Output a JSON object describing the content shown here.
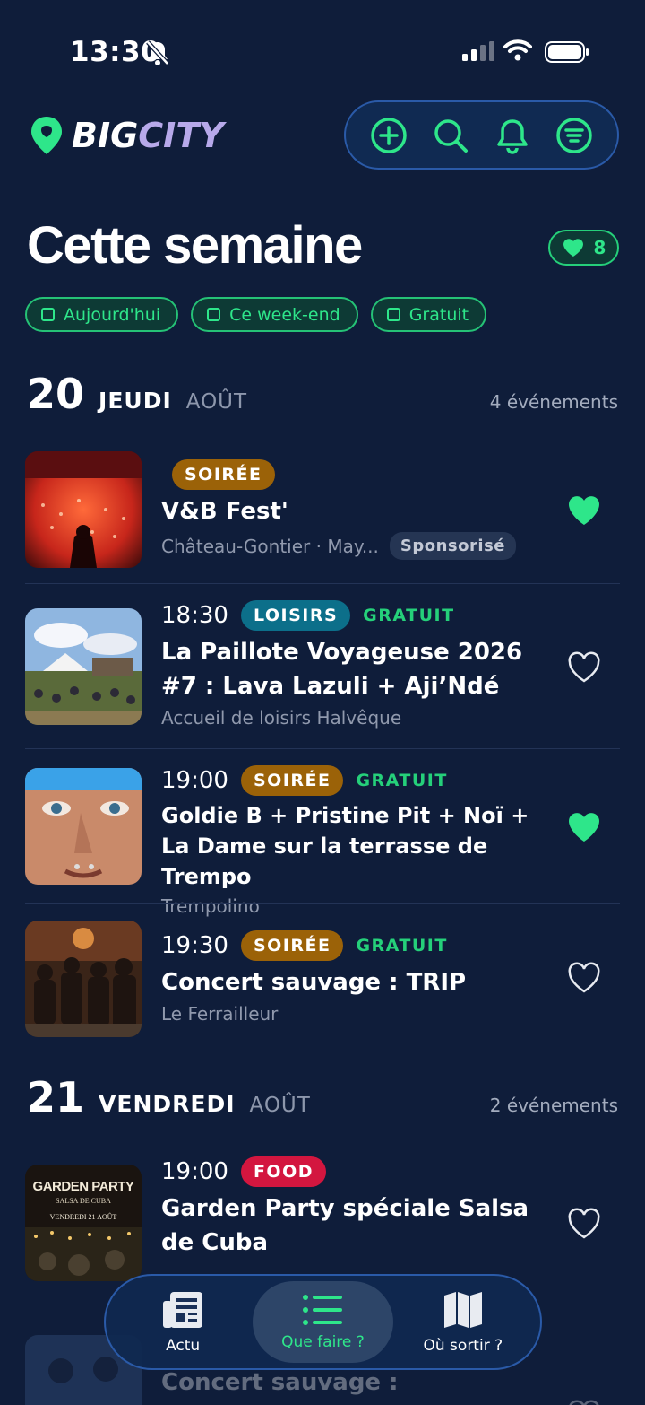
{
  "status_bar": {
    "time": "13:30"
  },
  "header": {
    "logo_big": "BIG",
    "logo_city": "CITY",
    "actions": [
      "add",
      "search",
      "notifications",
      "filters"
    ]
  },
  "page": {
    "title": "Cette semaine",
    "favorites_count": "8"
  },
  "filters": [
    {
      "label": "Aujourd'hui"
    },
    {
      "label": "Ce week-end"
    },
    {
      "label": "Gratuit"
    }
  ],
  "days": [
    {
      "number": "20",
      "weekday": "JEUDI",
      "month": "AOÛT",
      "count": "4 événements",
      "events": [
        {
          "time": "",
          "category": "SOIRÉE",
          "free": "",
          "title": "V&B Fest'",
          "place": "Château-Gontier · May...",
          "sponsored": "Sponsorisé",
          "favorited": true,
          "thumb_icon": "concert-crowd-image"
        },
        {
          "time": "18:30",
          "category": "LOISIRS",
          "free": "GRATUIT",
          "title": "La Paillote Voyageuse 2026 #7 : Lava Lazuli + Aji’Ndé",
          "place": "Accueil de loisirs Halvêque",
          "sponsored": "",
          "favorited": false,
          "thumb_icon": "outdoor-festival-image"
        },
        {
          "time": "19:00",
          "category": "SOIRÉE",
          "free": "GRATUIT",
          "title": "Goldie B + Pristine Pit + Noï + La Dame sur la terrasse de Trempo",
          "place": "Trempolino",
          "sponsored": "",
          "favorited": true,
          "thumb_icon": "face-portrait-image"
        },
        {
          "time": "19:30",
          "category": "SOIRÉE",
          "free": "GRATUIT",
          "title": "Concert sauvage : TRIP",
          "place": "Le Ferrailleur",
          "sponsored": "",
          "favorited": false,
          "thumb_icon": "band-photo-image"
        }
      ]
    },
    {
      "number": "21",
      "weekday": "VENDREDI",
      "month": "AOÛT",
      "count": "2 événements",
      "events": [
        {
          "time": "19:00",
          "category": "FOOD",
          "free": "",
          "title": "Garden Party spéciale Salsa de Cuba",
          "place": "",
          "sponsored": "",
          "favorited": false,
          "thumb_icon": "garden-party-poster-image",
          "poster_title": "GARDEN PARTY",
          "poster_sub": "SALSA DE CUBA",
          "poster_date": "VENDREDI 21 AOÛT"
        },
        {
          "time": "",
          "category": "",
          "free": "",
          "title": "Concert sauvage :",
          "place": "",
          "sponsored": "",
          "favorited": false,
          "thumb_icon": "band-photo-image"
        }
      ]
    }
  ],
  "bottom_nav": [
    {
      "label": "Actu",
      "icon": "newspaper-icon",
      "active": false
    },
    {
      "label": "Que faire ?",
      "icon": "list-icon",
      "active": true
    },
    {
      "label": "Où sortir ?",
      "icon": "map-icon",
      "active": false
    }
  ],
  "colors": {
    "background": "#0f1d3a",
    "accent": "#2ee68a",
    "soiree": "#9b6208",
    "loisirs": "#0c6f8a",
    "food": "#d3163f"
  }
}
